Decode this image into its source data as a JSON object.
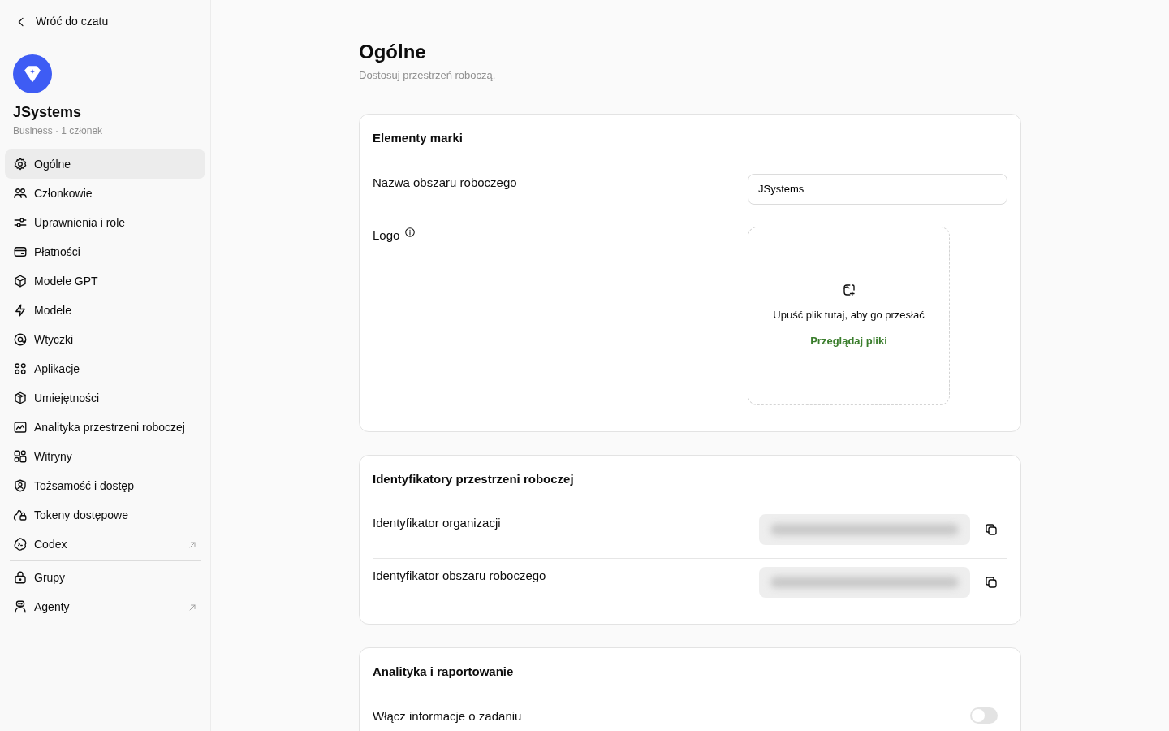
{
  "back_link": "Wróć do czatu",
  "workspace": {
    "name": "JSystems",
    "meta": "Business · 1 członek"
  },
  "nav_groups": [
    [
      {
        "label": "Ogólne",
        "selected": true,
        "external": false
      },
      {
        "label": "Członkowie",
        "selected": false,
        "external": false
      },
      {
        "label": "Uprawnienia i role",
        "selected": false,
        "external": false
      },
      {
        "label": "Płatności",
        "selected": false,
        "external": false
      },
      {
        "label": "Modele GPT",
        "selected": false,
        "external": false
      },
      {
        "label": "Modele",
        "selected": false,
        "external": false
      },
      {
        "label": "Wtyczki",
        "selected": false,
        "external": false
      },
      {
        "label": "Aplikacje",
        "selected": false,
        "external": false
      },
      {
        "label": "Umiejętności",
        "selected": false,
        "external": false
      },
      {
        "label": "Analityka przestrzeni roboczej",
        "selected": false,
        "external": false
      },
      {
        "label": "Witryny",
        "selected": false,
        "external": false
      },
      {
        "label": "Tożsamość i dostęp",
        "selected": false,
        "external": false
      },
      {
        "label": "Tokeny dostępowe",
        "selected": false,
        "external": false
      },
      {
        "label": "Codex",
        "selected": false,
        "external": true
      }
    ],
    [
      {
        "label": "Grupy",
        "selected": false,
        "external": false
      },
      {
        "label": "Agenty",
        "selected": false,
        "external": true
      }
    ]
  ],
  "page": {
    "title": "Ogólne",
    "subtitle": "Dostosuj przestrzeń roboczą."
  },
  "sections": [
    {
      "title": "Elementy marki",
      "rows": [
        {
          "kind": "text",
          "label": "Nazwa obszaru roboczego",
          "value": "JSystems"
        },
        {
          "kind": "upload",
          "label": "Logo",
          "drop_text": "Upuść plik tutaj, aby go przesłać",
          "browse": "Przeglądaj pliki"
        }
      ]
    },
    {
      "title": "Identyfikatory przestrzeni roboczej",
      "rows": [
        {
          "kind": "secret",
          "label": "Identyfikator organizacji"
        },
        {
          "kind": "secret",
          "label": "Identyfikator obszaru roboczego"
        }
      ]
    },
    {
      "title": "Analityka i raportowanie",
      "rows": [
        {
          "kind": "toggle",
          "label": "Włącz informacje o zadaniu",
          "on": false
        }
      ]
    }
  ]
}
